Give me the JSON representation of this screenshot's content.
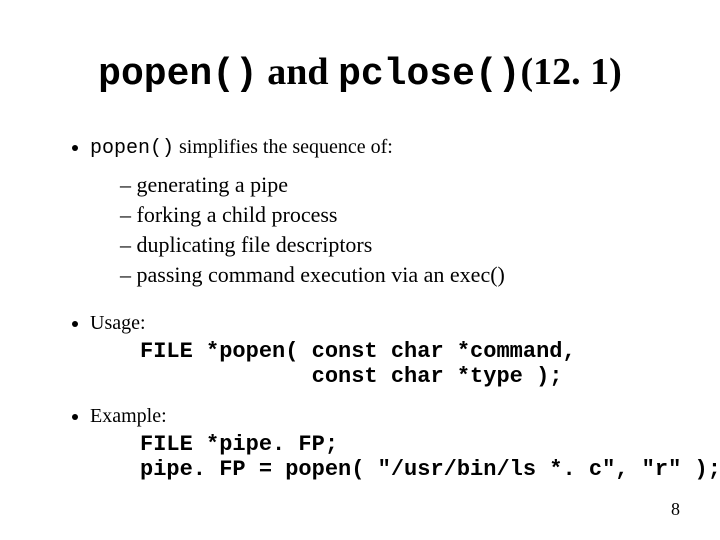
{
  "title": {
    "code1": "popen()",
    "mid": " and ",
    "code2": "pclose()",
    "ref": "(12. 1)"
  },
  "intro": {
    "code": "popen()",
    "rest": " simplifies the sequence of:"
  },
  "subitems": [
    "generating a pipe",
    "forking a child process",
    "duplicating file descriptors",
    "passing command execution via an exec()"
  ],
  "usage": {
    "label": "Usage:",
    "line1": "FILE *popen( const char *command,",
    "line2": "             const char *type );"
  },
  "example": {
    "label": "Example:",
    "line1": "FILE *pipe. FP;",
    "line2": "pipe. FP = popen( \"/usr/bin/ls *. c\", \"r\" );"
  },
  "page": "8"
}
